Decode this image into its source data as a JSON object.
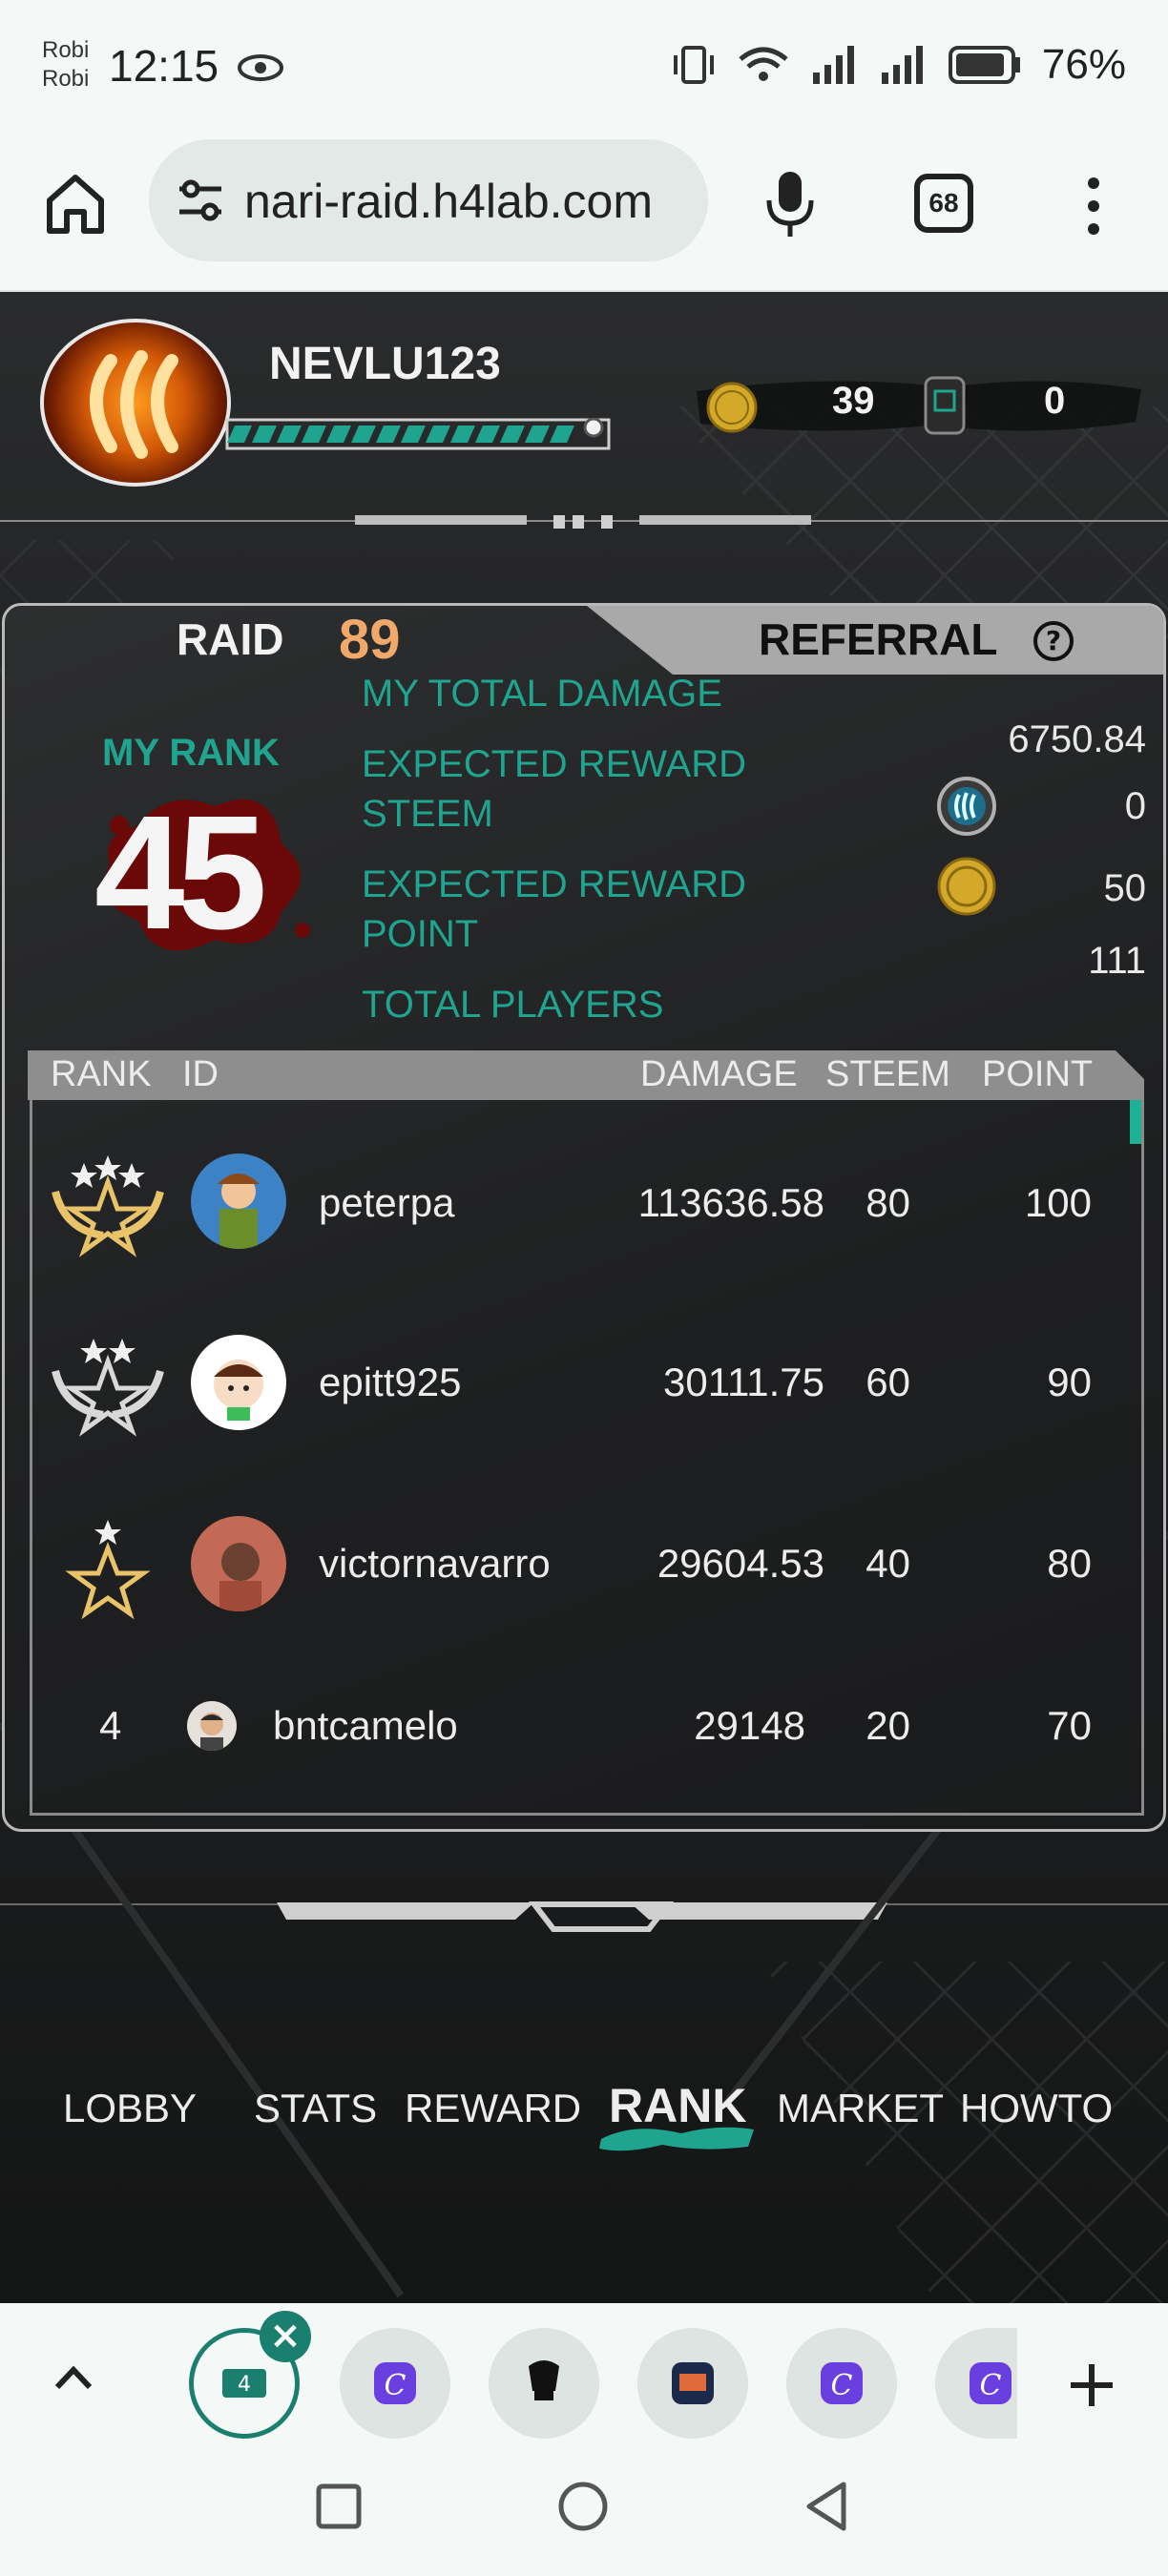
{
  "status_bar": {
    "carrier_line1": "Robi",
    "carrier_line2": "Robi",
    "time": "12:15",
    "battery": "76%"
  },
  "browser": {
    "url": "nari-raid.h4lab.com",
    "tab_count": "68"
  },
  "player": {
    "name": "NEVLU123",
    "coins": "39",
    "tickets": "0"
  },
  "panel": {
    "tab_raid": "RAID",
    "raid_number": "89",
    "tab_referral": "REFERRAL",
    "help": "?",
    "my_rank_label": "MY RANK",
    "my_rank": "45",
    "stats": {
      "total_damage_label": "MY TOTAL DAMAGE",
      "total_damage": "6750.84",
      "reward_steem_label_1": "EXPECTED REWARD",
      "reward_steem_label_2": "STEEM",
      "reward_steem": "0",
      "reward_point_label_1": "EXPECTED REWARD",
      "reward_point_label_2": "POINT",
      "reward_point": "50",
      "total_players_label": "TOTAL PLAYERS",
      "total_players": "111"
    }
  },
  "table": {
    "headers": {
      "rank": "RANK",
      "id": "ID",
      "damage": "DAMAGE",
      "steem": "STEEM",
      "point": "POINT"
    },
    "rows": [
      {
        "rank": "1",
        "id": "peterpa",
        "damage": "113636.58",
        "steem": "80",
        "point": "100"
      },
      {
        "rank": "2",
        "id": "epitt925",
        "damage": "30111.75",
        "steem": "60",
        "point": "90"
      },
      {
        "rank": "3",
        "id": "victornavarro",
        "damage": "29604.53",
        "steem": "40",
        "point": "80"
      },
      {
        "rank": "4",
        "id": "bntcamelo",
        "damage": "29148",
        "steem": "20",
        "point": "70"
      }
    ]
  },
  "nav": {
    "lobby": "LOBBY",
    "stats": "STATS",
    "reward": "REWARD",
    "rank": "RANK",
    "market": "MARKET",
    "howto": "HOWTO"
  },
  "colors": {
    "accent_teal": "#1fa58f",
    "raid_orange": "#f0a86b",
    "blood_red": "#7a0a0a"
  }
}
